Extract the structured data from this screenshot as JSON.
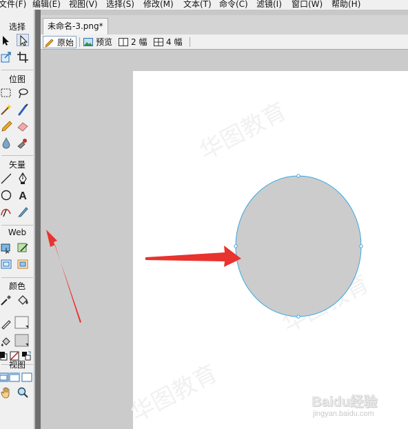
{
  "menu": [
    "文件(F)",
    "编辑(E)",
    "视图(V)",
    "选择(S)",
    "修改(M)",
    "文本(T)",
    "命令(C)",
    "滤镜(I)",
    "窗口(W)",
    "帮助(H)"
  ],
  "toolbox": {
    "sections": {
      "select": "选择",
      "bitmap": "位图",
      "vector": "矢量",
      "web": "Web",
      "colors": "颜色",
      "view": "视图"
    },
    "text_tool_glyph": "A"
  },
  "document": {
    "tab_title": "未命名-3.png*",
    "views": {
      "original": "原始",
      "preview": "预览",
      "two_up": "2 幅",
      "four_up": "4 幅"
    },
    "active_view": "original",
    "canvas_color": "#ffffff",
    "shape": {
      "type": "ellipse",
      "fill": "#cccccc",
      "stroke": "#3aa7e0",
      "selected": true
    }
  },
  "annotations": {
    "arrow_color": "#e8332f",
    "count": 2
  },
  "watermark": {
    "brand": "Baidu经验",
    "url": "jingyan.baidu.com",
    "repeating_text": "华图教育"
  }
}
